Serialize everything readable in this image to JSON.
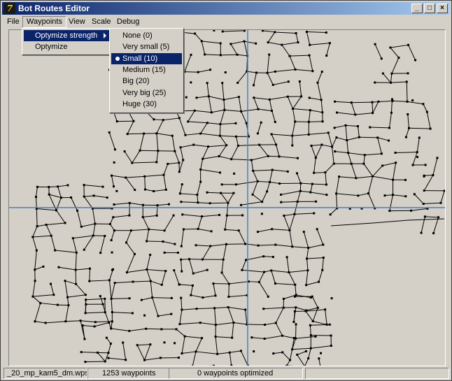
{
  "window": {
    "title": "Bot Routes Editor"
  },
  "titlebar_buttons": {
    "minimize": "_",
    "maximize": "□",
    "close": "×"
  },
  "menubar": [
    {
      "label": "File"
    },
    {
      "label": "Waypoints"
    },
    {
      "label": "View"
    },
    {
      "label": "Scale"
    },
    {
      "label": "Debug"
    }
  ],
  "waypoints_menu": {
    "items": [
      {
        "label": "Optymize strength"
      },
      {
        "label": "Optymize"
      }
    ]
  },
  "strength_submenu": {
    "items": [
      {
        "label": "None (0)"
      },
      {
        "label": "Very small (5)"
      },
      {
        "label": "Small (10)"
      },
      {
        "label": "Medium (15)"
      },
      {
        "label": "Big (20)"
      },
      {
        "label": "Very big (25)"
      },
      {
        "label": "Huge (30)"
      }
    ],
    "selected_index": 2
  },
  "statusbar": {
    "file": "_20_mp_kam5_dm.wps",
    "waypoint_count": "1253 waypoints",
    "optimized": "0 waypoints optimized"
  },
  "colors": {
    "highlight": "#0a246a",
    "crosshair": "#4a7fc0",
    "graph_line": "#000000",
    "canvas_bg": "#d4d0c8"
  }
}
